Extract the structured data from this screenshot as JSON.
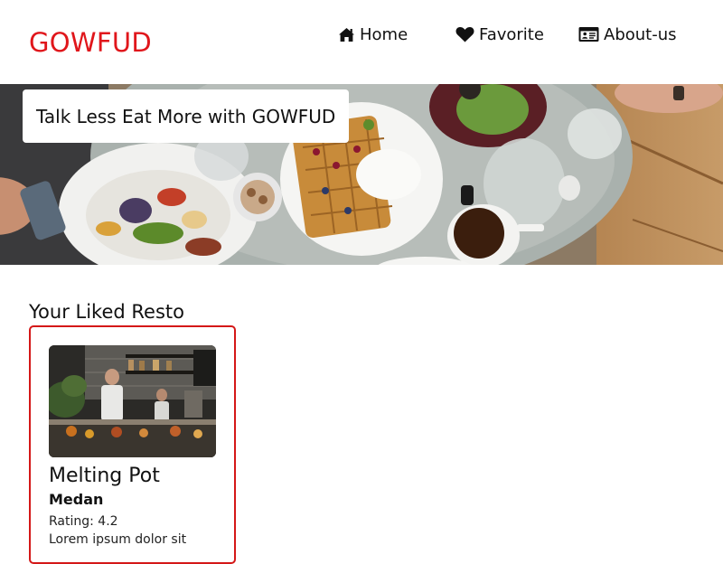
{
  "header": {
    "brand": "GOWFUD",
    "nav": [
      {
        "label": "Home",
        "icon": "home-icon"
      },
      {
        "label": "Favorite",
        "icon": "heart-icon"
      },
      {
        "label": "About-us",
        "icon": "id-card-icon"
      }
    ]
  },
  "hero": {
    "tagline": "Talk Less Eat More with GOWFUD",
    "image": "table-of-food-photo"
  },
  "main": {
    "section_title": "Your Liked Resto",
    "restaurants": [
      {
        "name": "Melting Pot",
        "city": "Medan",
        "rating_label": "Rating: 4.2",
        "description": "Lorem ipsum dolor sit",
        "image": "restaurant-kitchen-photo"
      }
    ]
  },
  "colors": {
    "brand": "#e0161b",
    "card_border": "#d41818",
    "background": "#ffffff",
    "text": "#111111"
  }
}
